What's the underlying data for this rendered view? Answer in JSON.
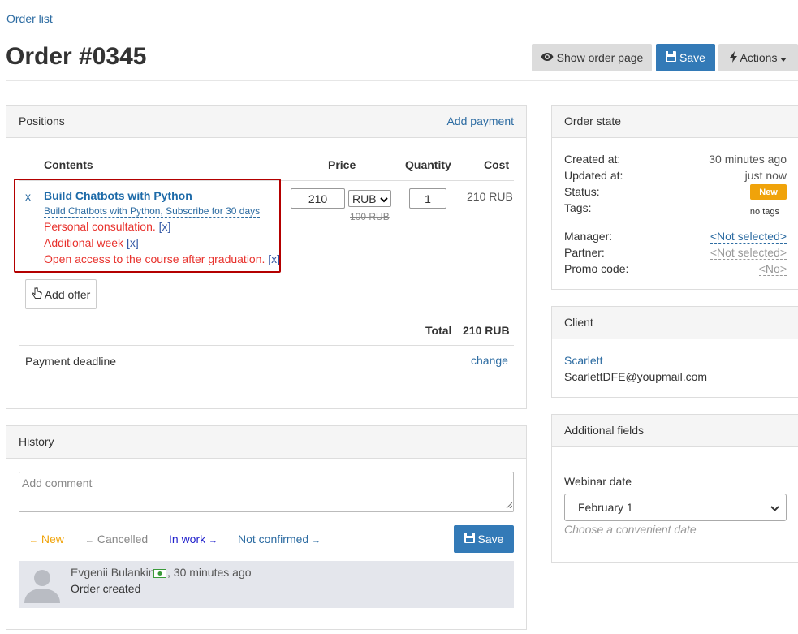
{
  "breadcrumb": "Order list",
  "page_title": "Order #0345",
  "toolbar": {
    "show_order_page": "Show order page",
    "save": "Save",
    "actions": "Actions"
  },
  "positions": {
    "title": "Positions",
    "add_payment": "Add payment",
    "headers": {
      "contents": "Contents",
      "price": "Price",
      "quantity": "Quantity",
      "cost": "Cost"
    },
    "item": {
      "remove": "x",
      "name": "Build Chatbots with Python",
      "subtitle": "Build Chatbots with Python, Subscribe for 30 days",
      "options": [
        {
          "label": "Personal consultation.",
          "remove": "[x]"
        },
        {
          "label": "Additional week",
          "remove": "[x]"
        },
        {
          "label": "Open access to the course after graduation.",
          "remove": "[x]"
        }
      ],
      "price": "210",
      "currency": "RUB",
      "old_price": "100 RUB",
      "quantity": "1",
      "cost": "210 RUB"
    },
    "add_offer": "Add offer",
    "total_label": "Total",
    "total_value": "210 RUB",
    "payment_deadline": "Payment deadline",
    "change": "change"
  },
  "order_state": {
    "title": "Order state",
    "created_label": "Created at:",
    "created_value": "30 minutes ago",
    "updated_label": "Updated at:",
    "updated_value": "just now",
    "status_label": "Status:",
    "status_value": "New",
    "tags_label": "Tags:",
    "tags_value": "no tags",
    "manager_label": "Manager:",
    "manager_value": "<Not selected>",
    "partner_label": "Partner:",
    "partner_value": "<Not selected>",
    "promo_label": "Promo code:",
    "promo_value": "<No>"
  },
  "client": {
    "title": "Client",
    "name": "Scarlett",
    "email": "ScarlettDFE@youpmail.com"
  },
  "additional_fields": {
    "title": "Additional fields",
    "webinar_label": "Webinar date",
    "webinar_value": "February 1",
    "webinar_hint": "Choose a convenient date"
  },
  "history": {
    "title": "History",
    "comment_placeholder": "Add comment",
    "statuses": [
      {
        "label": "New",
        "arrow": "←",
        "color": "#f0a30a"
      },
      {
        "label": "Cancelled",
        "arrow": "←",
        "color": "#888888"
      },
      {
        "label": "In work",
        "arrow": "→",
        "color": "#2222cc"
      },
      {
        "label": "Not confirmed",
        "arrow": "→",
        "color": "#2d6ca2"
      }
    ],
    "save": "Save",
    "entry": {
      "author": "Evgenii Bulankin",
      "time": ", 30 minutes ago",
      "text": "Order created"
    }
  },
  "colors": {
    "primary": "#337ab7",
    "link": "#2d6ca2",
    "danger": "#e8322d",
    "highlight_border": "#b40000",
    "status_new": "#f0a30a"
  }
}
